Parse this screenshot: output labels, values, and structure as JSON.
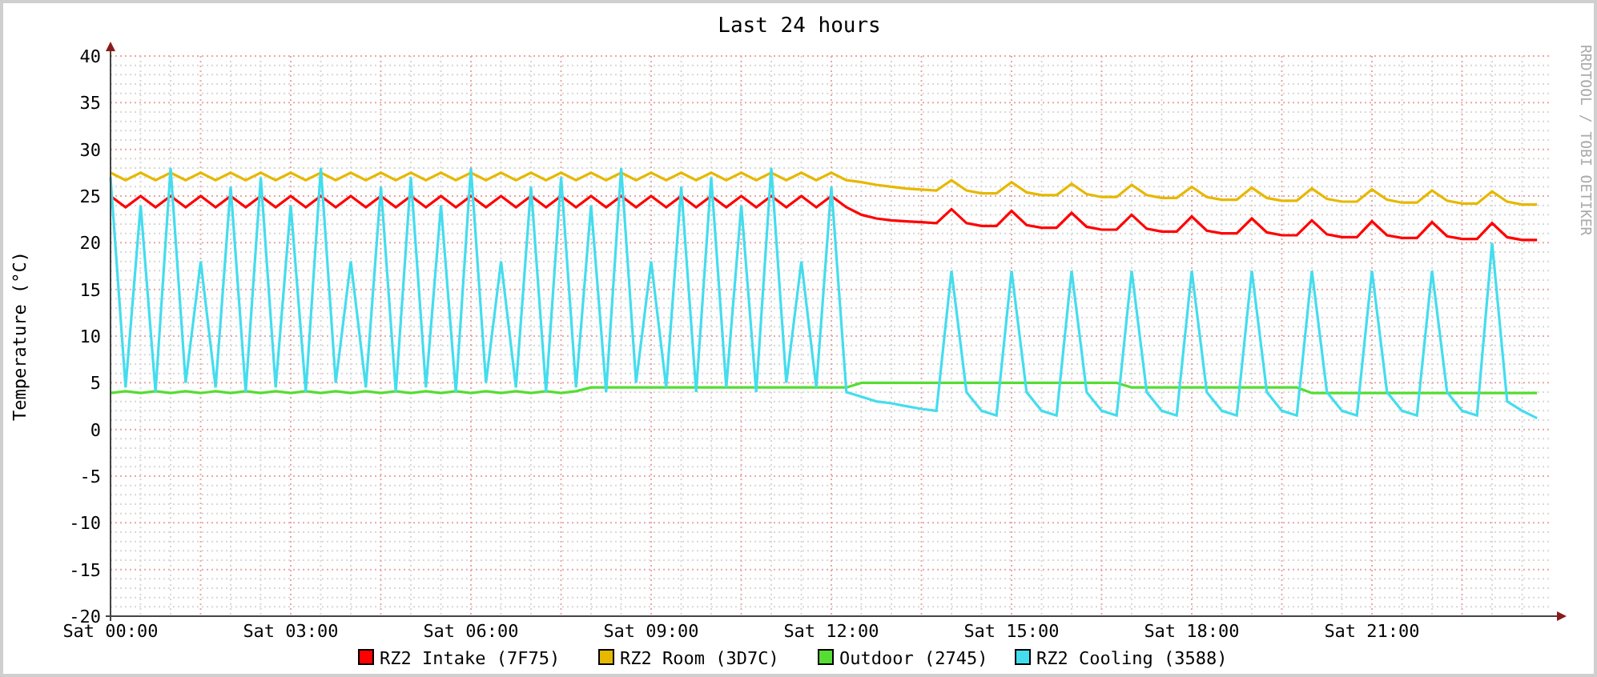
{
  "chart_data": {
    "type": "line",
    "grid": true,
    "legend": "bottom",
    "title": "Last 24 hours",
    "ylabel": "Temperature (°C)",
    "ylim": [
      -20,
      40
    ],
    "yticks": [
      -20,
      -15,
      -10,
      -5,
      0,
      5,
      10,
      15,
      20,
      25,
      30,
      35,
      40
    ],
    "categories": [
      "Sat 00:00",
      null,
      null,
      null,
      null,
      null,
      null,
      null,
      null,
      null,
      null,
      null,
      "Sat 03:00",
      null,
      null,
      null,
      null,
      null,
      null,
      null,
      null,
      null,
      null,
      null,
      "Sat 06:00",
      null,
      null,
      null,
      null,
      null,
      null,
      null,
      null,
      null,
      null,
      null,
      "Sat 09:00",
      null,
      null,
      null,
      null,
      null,
      null,
      null,
      null,
      null,
      null,
      null,
      "Sat 12:00",
      null,
      null,
      null,
      null,
      null,
      null,
      null,
      null,
      null,
      null,
      null,
      "Sat 15:00",
      null,
      null,
      null,
      null,
      null,
      null,
      null,
      null,
      null,
      null,
      null,
      "Sat 18:00",
      null,
      null,
      null,
      null,
      null,
      null,
      null,
      null,
      null,
      null,
      null,
      "Sat 21:00",
      null,
      null,
      null,
      null,
      null,
      null,
      null,
      null,
      null,
      null,
      null
    ],
    "series": [
      {
        "name": "RZ2 Intake (7F75)",
        "color": "#ff0000",
        "values": [
          25,
          23.8,
          25,
          23.8,
          25,
          23.8,
          25,
          23.8,
          25,
          23.8,
          25,
          23.8,
          25,
          23.8,
          25,
          23.8,
          25,
          23.8,
          25,
          23.8,
          25,
          23.8,
          25,
          23.8,
          25,
          23.8,
          25,
          23.8,
          25,
          23.8,
          25,
          23.8,
          25,
          23.8,
          25,
          23.8,
          25,
          23.8,
          25,
          23.8,
          25,
          23.8,
          25,
          23.8,
          25,
          23.8,
          25,
          23.8,
          25,
          23.8,
          23,
          22.6,
          22.4,
          22.3,
          22.2,
          22.1,
          23.6,
          22.1,
          21.8,
          21.8,
          23.4,
          21.9,
          21.6,
          21.6,
          23.2,
          21.7,
          21.4,
          21.4,
          23,
          21.5,
          21.2,
          21.2,
          22.8,
          21.3,
          21,
          21,
          22.6,
          21.1,
          20.8,
          20.8,
          22.4,
          20.9,
          20.6,
          20.6,
          22.3,
          20.8,
          20.5,
          20.5,
          22.2,
          20.7,
          20.4,
          20.4,
          22.1,
          20.6,
          20.3,
          20.3
        ]
      },
      {
        "name": "RZ2 Room (3D7C)",
        "color": "#e6b800",
        "values": [
          27.5,
          26.7,
          27.5,
          26.7,
          27.5,
          26.7,
          27.5,
          26.7,
          27.5,
          26.7,
          27.5,
          26.7,
          27.5,
          26.7,
          27.5,
          26.7,
          27.5,
          26.7,
          27.5,
          26.7,
          27.5,
          26.7,
          27.5,
          26.7,
          27.5,
          26.7,
          27.5,
          26.7,
          27.5,
          26.7,
          27.5,
          26.7,
          27.5,
          26.7,
          27.5,
          26.7,
          27.5,
          26.7,
          27.5,
          26.7,
          27.5,
          26.7,
          27.5,
          26.7,
          27.5,
          26.7,
          27.5,
          26.7,
          27.5,
          26.7,
          26.5,
          26.2,
          26,
          25.8,
          25.7,
          25.6,
          26.7,
          25.6,
          25.3,
          25.3,
          26.5,
          25.4,
          25.1,
          25.1,
          26.3,
          25.2,
          24.9,
          24.9,
          26.2,
          25.1,
          24.8,
          24.8,
          26,
          24.9,
          24.6,
          24.6,
          25.9,
          24.8,
          24.5,
          24.5,
          25.8,
          24.7,
          24.4,
          24.4,
          25.7,
          24.6,
          24.3,
          24.3,
          25.6,
          24.5,
          24.2,
          24.2,
          25.5,
          24.4,
          24.1,
          24.1
        ]
      },
      {
        "name": "Outdoor (2745)",
        "color": "#55dd33",
        "values": [
          3.9,
          4.1,
          3.9,
          4.1,
          3.9,
          4.1,
          3.9,
          4.1,
          3.9,
          4.1,
          3.9,
          4.1,
          3.9,
          4.1,
          3.9,
          4.1,
          3.9,
          4.1,
          3.9,
          4.1,
          3.9,
          4.1,
          3.9,
          4.1,
          3.9,
          4.1,
          3.9,
          4.1,
          3.9,
          4.1,
          3.9,
          4.1,
          4.5,
          4.5,
          4.5,
          4.5,
          4.5,
          4.5,
          4.5,
          4.5,
          4.5,
          4.5,
          4.5,
          4.5,
          4.5,
          4.5,
          4.5,
          4.5,
          4.5,
          4.5,
          5,
          5,
          5,
          5,
          5,
          5,
          5,
          5,
          5,
          5,
          5,
          5,
          5,
          5,
          5,
          5,
          5,
          5,
          4.5,
          4.5,
          4.5,
          4.5,
          4.5,
          4.5,
          4.5,
          4.5,
          4.5,
          4.5,
          4.5,
          4.5,
          3.9,
          3.9,
          3.9,
          3.9,
          3.9,
          3.9,
          3.9,
          3.9,
          3.9,
          3.9,
          3.9,
          3.9,
          3.9,
          3.9,
          3.9,
          3.9
        ]
      },
      {
        "name": "RZ2 Cooling (3588)",
        "color": "#44ddee",
        "values": [
          27,
          4.5,
          24,
          4,
          28,
          5,
          18,
          4.5,
          26,
          4,
          27,
          4.5,
          24,
          4,
          28,
          5,
          18,
          4.5,
          26,
          4,
          27,
          4.5,
          24,
          4,
          28,
          5,
          18,
          4.5,
          26,
          4,
          27,
          4.5,
          24,
          4,
          28,
          5,
          18,
          4.5,
          26,
          4,
          27,
          4.5,
          24,
          4,
          28,
          5,
          18,
          4.5,
          26,
          4,
          3.5,
          3,
          2.8,
          2.5,
          2.2,
          2,
          17,
          4,
          2,
          1.5,
          17,
          4,
          2,
          1.5,
          17,
          4,
          2,
          1.5,
          17,
          4,
          2,
          1.5,
          17,
          4,
          2,
          1.5,
          17,
          4,
          2,
          1.5,
          17,
          4,
          2,
          1.5,
          17,
          4,
          2,
          1.5,
          17,
          4,
          2,
          1.5,
          20,
          3,
          2,
          1.2
        ]
      }
    ]
  },
  "credit": "RRDTOOL / TOBI OETIKER"
}
